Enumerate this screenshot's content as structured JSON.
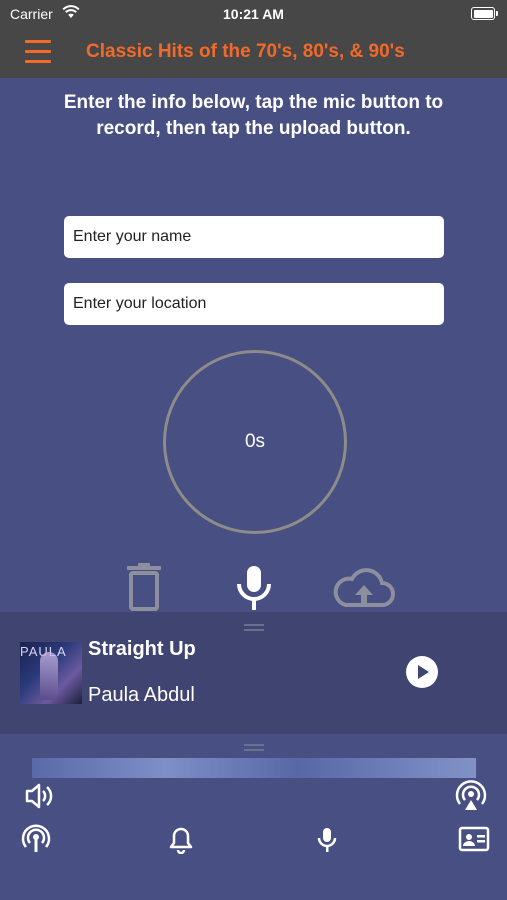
{
  "status": {
    "carrier": "Carrier",
    "time": "10:21 AM"
  },
  "header": {
    "title": "Classic Hits of the 70's, 80's, & 90's",
    "menu_icon": "hamburger-menu-icon"
  },
  "main": {
    "instructions": "Enter the info below, tap the mic button to record, then tap the upload button.",
    "name_placeholder": "Enter your name",
    "location_placeholder": "Enter your location",
    "timer": "0s",
    "controls": [
      "trash-icon",
      "microphone-icon",
      "upload-cloud-icon"
    ]
  },
  "now_playing": {
    "album_text": "PAULA",
    "title": "Straight Up",
    "artist": "Paula Abdul"
  },
  "bottom_bar": {
    "icons": [
      "speaker-icon",
      "airplay-icon",
      "broadcast-icon",
      "bell-icon",
      "microphone-icon",
      "contact-card-icon"
    ]
  },
  "colors": {
    "accent": "#f26a2a",
    "background": "#474f83",
    "header": "#474747",
    "player": "#3f4570"
  }
}
